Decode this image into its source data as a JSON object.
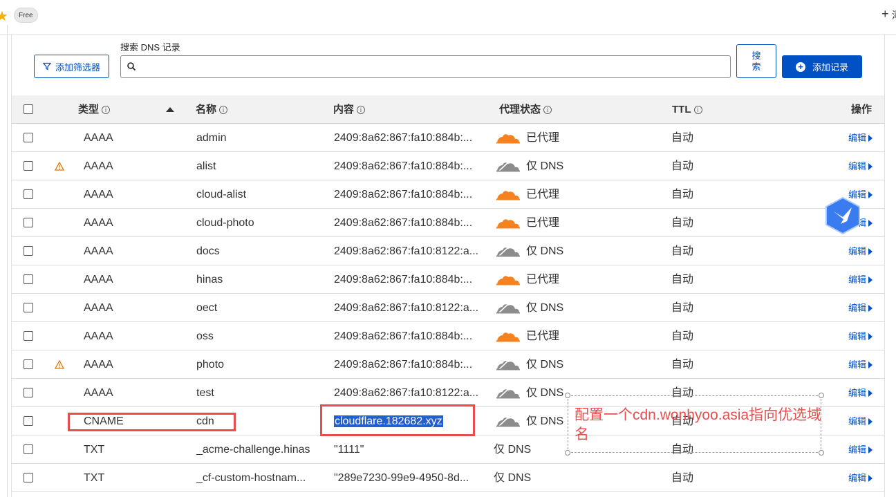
{
  "topbar": {
    "plan_badge": "Free",
    "plus_label": "+",
    "right_text": "添"
  },
  "toolbar": {
    "filter_button": "添加筛选器",
    "search_label": "搜索 DNS 记录",
    "search_value": "",
    "search_button": "搜索",
    "add_button": "添加记录"
  },
  "columns": {
    "type": "类型",
    "name": "名称",
    "content": "内容",
    "proxy": "代理状态",
    "ttl": "TTL",
    "actions": "操作"
  },
  "rows": [
    {
      "type": "AAAA",
      "name": "admin",
      "content": "2409:8a62:867:fa10:884b:...",
      "proxy": "已代理",
      "proxied": true,
      "ttl": "自动",
      "edit": "编辑",
      "warning": false
    },
    {
      "type": "AAAA",
      "name": "alist",
      "content": "2409:8a62:867:fa10:884b:...",
      "proxy": "仅 DNS",
      "proxied": false,
      "ttl": "自动",
      "edit": "编辑",
      "warning": true
    },
    {
      "type": "AAAA",
      "name": "cloud-alist",
      "content": "2409:8a62:867:fa10:884b:...",
      "proxy": "已代理",
      "proxied": true,
      "ttl": "自动",
      "edit": "编辑",
      "warning": false
    },
    {
      "type": "AAAA",
      "name": "cloud-photo",
      "content": "2409:8a62:867:fa10:884b:...",
      "proxy": "已代理",
      "proxied": true,
      "ttl": "自动",
      "edit": "编辑",
      "warning": false
    },
    {
      "type": "AAAA",
      "name": "docs",
      "content": "2409:8a62:867:fa10:8122:a...",
      "proxy": "仅 DNS",
      "proxied": false,
      "ttl": "自动",
      "edit": "编辑",
      "warning": false
    },
    {
      "type": "AAAA",
      "name": "hinas",
      "content": "2409:8a62:867:fa10:884b:...",
      "proxy": "已代理",
      "proxied": true,
      "ttl": "自动",
      "edit": "编辑",
      "warning": false
    },
    {
      "type": "AAAA",
      "name": "oect",
      "content": "2409:8a62:867:fa10:8122:a...",
      "proxy": "仅 DNS",
      "proxied": false,
      "ttl": "自动",
      "edit": "编辑",
      "warning": false
    },
    {
      "type": "AAAA",
      "name": "oss",
      "content": "2409:8a62:867:fa10:884b:...",
      "proxy": "已代理",
      "proxied": true,
      "ttl": "自动",
      "edit": "编辑",
      "warning": false
    },
    {
      "type": "AAAA",
      "name": "photo",
      "content": "2409:8a62:867:fa10:884b:...",
      "proxy": "仅 DNS",
      "proxied": false,
      "ttl": "自动",
      "edit": "编辑",
      "warning": true
    },
    {
      "type": "AAAA",
      "name": "test",
      "content": "2409:8a62:867:fa10:8122:a...",
      "proxy": "仅 DNS",
      "proxied": false,
      "ttl": "自动",
      "edit": "编辑",
      "warning": false
    },
    {
      "type": "CNAME",
      "name": "cdn",
      "content": "cloudflare.182682.xyz",
      "proxy": "仅 DNS",
      "proxied": false,
      "ttl": "自动",
      "edit": "编辑",
      "warning": false,
      "selected_content": true
    },
    {
      "type": "TXT",
      "name": "_acme-challenge.hinas",
      "content": "\"1111\"",
      "proxy": "仅 DNS",
      "proxied": null,
      "ttl": "自动",
      "edit": "编辑",
      "warning": false
    },
    {
      "type": "TXT",
      "name": "_cf-custom-hostnam...",
      "content": "\"289e7230-99e9-4950-8d...",
      "proxy": "仅 DNS",
      "proxied": null,
      "ttl": "自动",
      "edit": "编辑",
      "warning": false
    }
  ],
  "annotation": {
    "text": "配置一个cdn.wonhyoo.asia指向优选域名",
    "color": "#e84d4d"
  },
  "colors": {
    "accent": "#0051c3",
    "proxied_cloud": "#f6821f",
    "dns_cloud": "#8c8c8c",
    "annotation_red": "#e84d4d"
  }
}
